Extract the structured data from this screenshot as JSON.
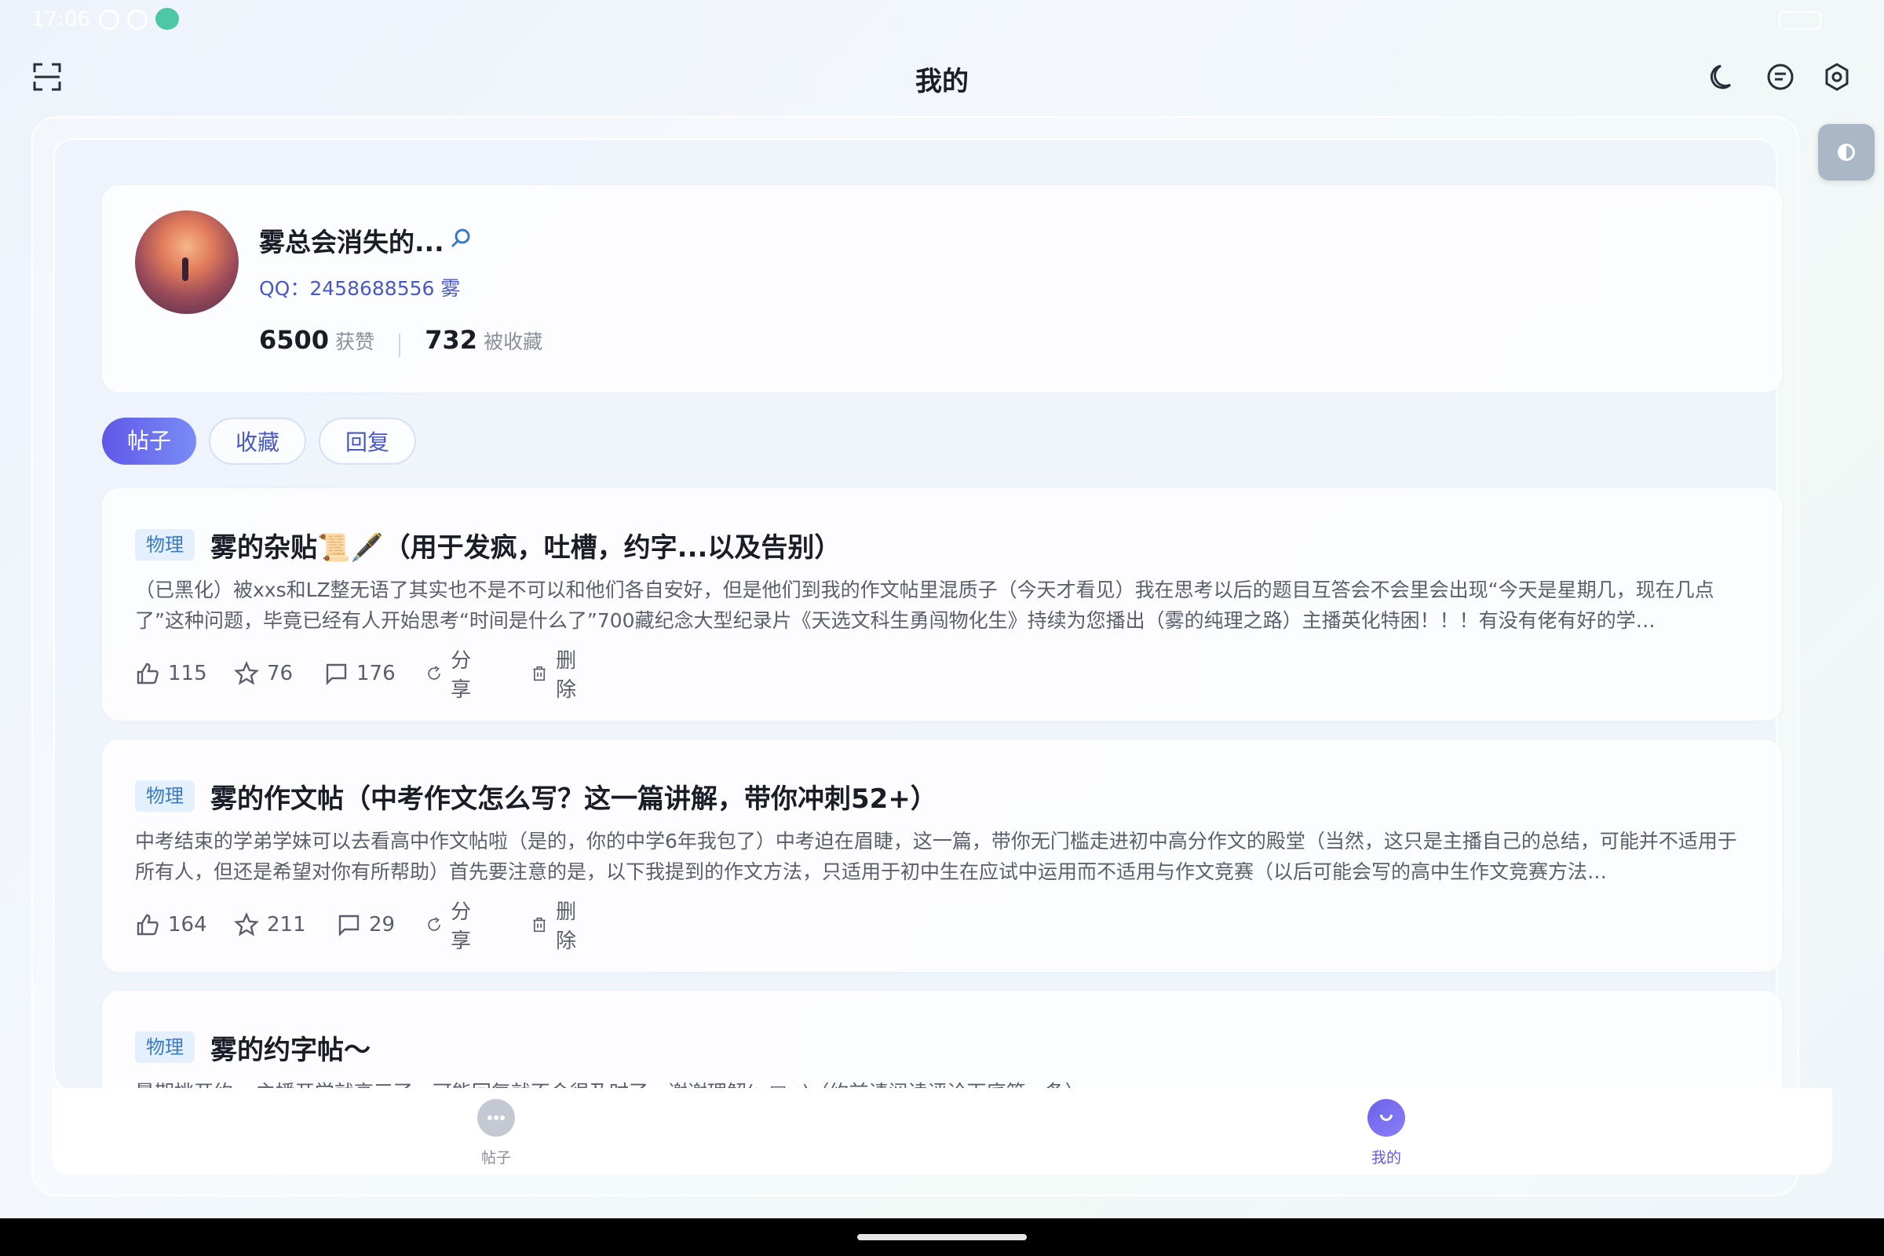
{
  "status_bar": {
    "time": "17:06"
  },
  "header": {
    "title": "我的"
  },
  "profile": {
    "username": "雾总会消失的...",
    "qq_text": "QQ：2458688556 雾",
    "likes_count": "6500",
    "likes_label": "获赞",
    "favorites_count": "732",
    "favorites_label": "被收藏"
  },
  "tabs": [
    {
      "label": "帖子",
      "active": true
    },
    {
      "label": "收藏",
      "active": false
    },
    {
      "label": "回复",
      "active": false
    }
  ],
  "posts": [
    {
      "tag": "物理",
      "title": "雾的杂贴📜🖋️（用于发疯，吐槽，约字...以及告别）",
      "excerpt": "（已黑化）被xxs和LZ整无语了其实也不是不可以和他们各自安好，但是他们到我的作文帖里混质子（今天才看见）我在思考以后的题目互答会不会里会出现“今天是星期几，现在几点了”这种问题，毕竟已经有人开始思考“时间是什么了”700藏纪念大型纪录片《天选文科生勇闯物化生》持续为您播出（雾的纯理之路）主播英化特困！！！有没有佬有好的学…",
      "likes": "115",
      "favorites": "76",
      "comments": "176",
      "share_label": "分享",
      "delete_label": "删除"
    },
    {
      "tag": "物理",
      "title": "雾的作文帖（中考作文怎么写？这一篇讲解，带你冲刺52+）",
      "excerpt": "中考结束的学弟学妹可以去看高中作文帖啦（是的，你的中学6年我包了）中考迫在眉睫，这一篇，带你无门槛走进初中高分作文的殿堂（当然，这只是主播自己的总结，可能并不适用于所有人，但还是希望对你有所帮助）首先要注意的是，以下我提到的作文方法，只适用于初中生在应试中运用而不适用与作文竞赛（以后可能会写的高中生作文竞赛方法…",
      "likes": "164",
      "favorites": "211",
      "comments": "29",
      "share_label": "分享",
      "delete_label": "删除"
    },
    {
      "tag": "物理",
      "title": "雾的约字帖～",
      "excerpt": "暑期挑开约~ 主播开学就高三了，可能回复就不会很及时了，谢谢理解(>▽<)（约前请阅读评论下底第一条）"
    }
  ],
  "bottom_nav": [
    {
      "label": "帖子",
      "active": false,
      "icon": "chat-bubble-icon"
    },
    {
      "label": "我的",
      "active": true,
      "icon": "smile-face-icon"
    }
  ],
  "colors": {
    "accent": "#5f58e8",
    "tag_bg": "#e4f0fb",
    "tag_text": "#3a7bc8"
  }
}
